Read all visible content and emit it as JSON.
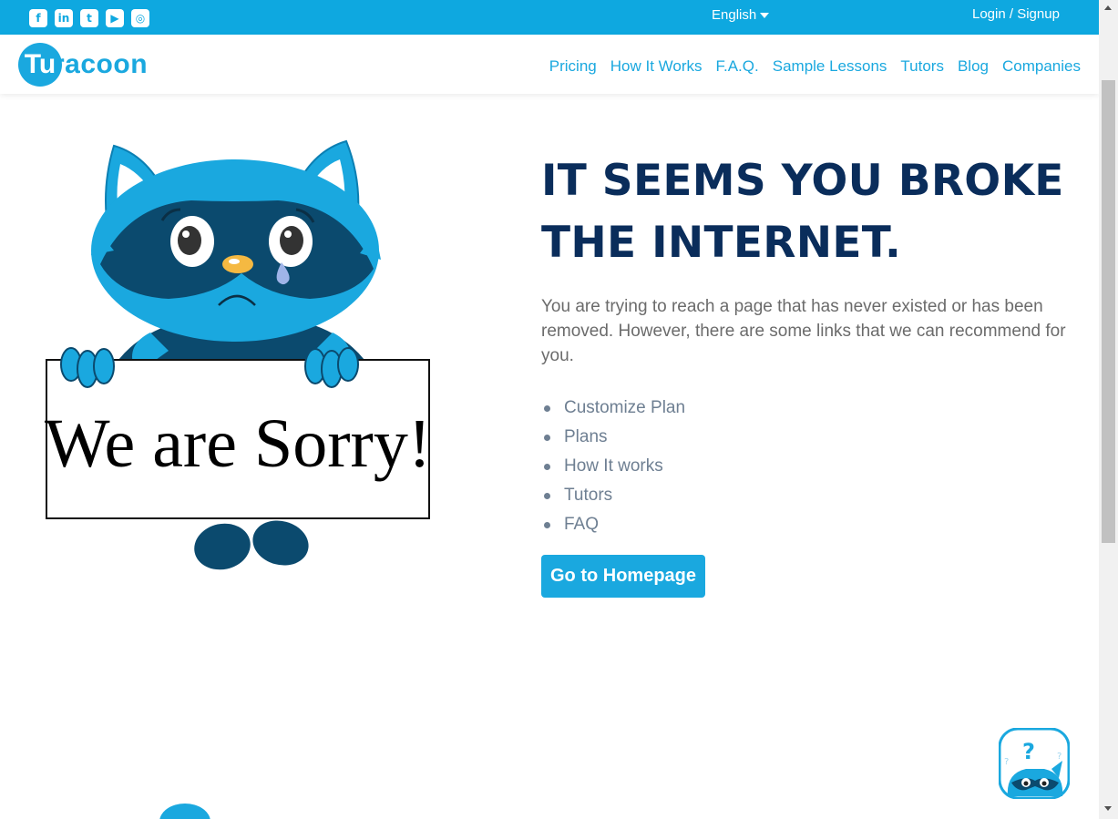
{
  "topbar": {
    "social": [
      {
        "icon": "facebook-icon",
        "glyph": "f"
      },
      {
        "icon": "linkedin-icon",
        "glyph": "in"
      },
      {
        "icon": "twitter-icon",
        "glyph": "t"
      },
      {
        "icon": "youtube-icon",
        "glyph": "▶"
      },
      {
        "icon": "instagram-icon",
        "glyph": "◎"
      }
    ],
    "language": "English",
    "login": "Login / Signup"
  },
  "nav": {
    "logo_mark": "Tu",
    "logo_rest": "racoon",
    "items": [
      "Pricing",
      "How It Works",
      "F.A.Q.",
      "Sample Lessons",
      "Tutors",
      "Blog",
      "Companies"
    ]
  },
  "illustration": {
    "sign_text": "We are Sorry!"
  },
  "main": {
    "heading_line1": "IT SEEMS YOU BROKE",
    "heading_line2": "THE INTERNET.",
    "description": "You are trying to reach a page that has never existed or has been removed. However, there are some links that we can recommend for you.",
    "links": [
      "Customize Plan",
      "Plans",
      "How It works",
      "Tutors",
      "FAQ"
    ],
    "button": "Go to Homepage"
  },
  "colors": {
    "brand": "#1aa8df",
    "heading": "#0a2d5b",
    "raccoon_dark": "#0b4a6e"
  }
}
